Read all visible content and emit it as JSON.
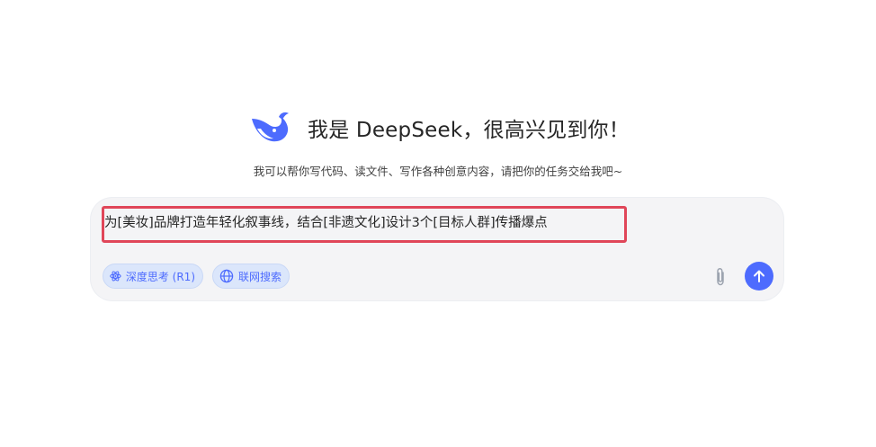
{
  "header": {
    "greeting": "我是 DeepSeek，很高兴见到你！",
    "subtitle": "我可以帮你写代码、读文件、写作各种创意内容，请把你的任务交给我吧~",
    "logo_icon": "whale-logo-icon"
  },
  "composer": {
    "input_text": "为[美妆]品牌打造年轻化叙事线，结合[非遗文化]设计3个[目标人群]传播爆点",
    "deep_think_label": "深度思考 (R1)",
    "web_search_label": "联网搜索",
    "deep_think_icon": "atom-icon",
    "web_search_icon": "globe-icon",
    "attach_icon": "paperclip-icon",
    "send_icon": "arrow-up-icon"
  },
  "colors": {
    "accent": "#4d6bfe",
    "highlight_border": "#e04659",
    "composer_bg": "#f4f4f6",
    "toggle_bg": "#dbe6fb"
  }
}
